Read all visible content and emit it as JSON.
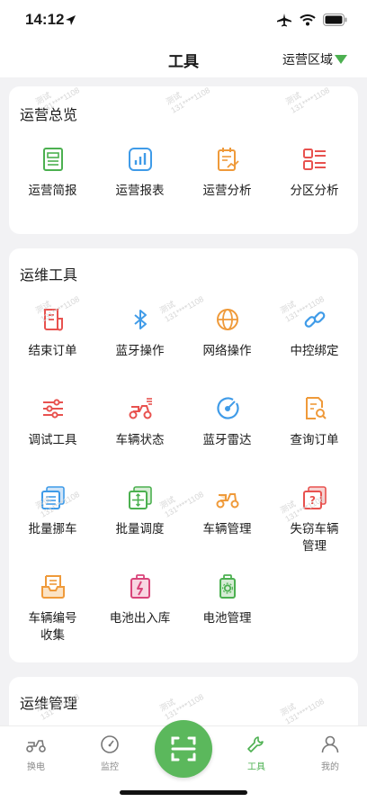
{
  "status_bar": {
    "time": "14:12"
  },
  "header": {
    "title": "工具",
    "region_label": "运营区域"
  },
  "watermark": {
    "line1": "测试",
    "line2": "131****1108"
  },
  "sections": [
    {
      "title": "运营总览",
      "items": [
        {
          "label": "运营简报",
          "icon": "report-doc-icon"
        },
        {
          "label": "运营报表",
          "icon": "bar-chart-icon"
        },
        {
          "label": "运营分析",
          "icon": "analysis-clipboard-icon"
        },
        {
          "label": "分区分析",
          "icon": "zone-list-icon"
        }
      ]
    },
    {
      "title": "运维工具",
      "items": [
        {
          "label": "结束订单",
          "icon": "end-order-icon"
        },
        {
          "label": "蓝牙操作",
          "icon": "bluetooth-icon"
        },
        {
          "label": "网络操作",
          "icon": "globe-icon"
        },
        {
          "label": "中控绑定",
          "icon": "link-icon"
        },
        {
          "label": "调试工具",
          "icon": "sliders-icon"
        },
        {
          "label": "车辆状态",
          "icon": "scooter-status-icon"
        },
        {
          "label": "蓝牙雷达",
          "icon": "radar-icon"
        },
        {
          "label": "查询订单",
          "icon": "search-order-icon"
        },
        {
          "label": "批量挪车",
          "icon": "batch-move-icon"
        },
        {
          "label": "批量调度",
          "icon": "batch-dispatch-icon"
        },
        {
          "label": "车辆管理",
          "icon": "scooter-manage-icon"
        },
        {
          "label": "失窃车辆\n管理",
          "icon": "stolen-vehicle-icon"
        },
        {
          "label": "车辆编号\n收集",
          "icon": "inbox-collect-icon"
        },
        {
          "label": "电池出入库",
          "icon": "battery-io-icon"
        },
        {
          "label": "电池管理",
          "icon": "battery-manage-icon"
        }
      ]
    },
    {
      "title": "运维管理",
      "items": []
    }
  ],
  "tabs": [
    {
      "label": "换电",
      "icon": "scooter-icon",
      "active": false
    },
    {
      "label": "监控",
      "icon": "gauge-icon",
      "active": false
    },
    {
      "label": "",
      "icon": "scan-icon",
      "active": false
    },
    {
      "label": "工具",
      "icon": "wrench-icon",
      "active": true
    },
    {
      "label": "我的",
      "icon": "person-icon",
      "active": false
    }
  ],
  "colors": {
    "green": "#4cb050",
    "blue": "#3f9be8",
    "orange": "#ef9a3a",
    "red": "#e8524f",
    "pink": "#d9447a",
    "scan_bg": "#5bb85c",
    "page_bg": "#f2f2f4"
  }
}
